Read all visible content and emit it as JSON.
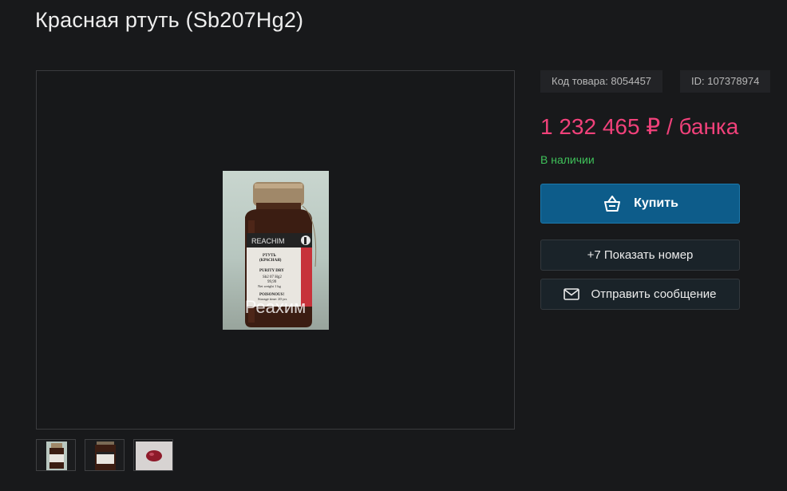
{
  "product": {
    "title": "Красная ртуть (Sb207Hg2)",
    "code_label": "Код товара: 8054457",
    "id_label": "ID: 107378974",
    "price": "1 232 465 ₽ / банка",
    "availability": "В наличии"
  },
  "photo": {
    "watermark": "Реахим",
    "label_brand": "REACHIM",
    "label_lines": [
      "РТУТЬ",
      "(КРАСНАЯ)",
      "PURITY DRY",
      "Sb2 07 Hg2",
      "99,99",
      "Net weight 1 kg",
      "POISONOUS!",
      "Storage time: 20 yrs"
    ]
  },
  "actions": {
    "buy_label": "Купить",
    "phone_label": "+7 Показать номер",
    "message_label": "Отправить сообщение"
  },
  "thumbnails": [
    {
      "name": "thumb-jar-front"
    },
    {
      "name": "thumb-jar-label"
    },
    {
      "name": "thumb-red-substance"
    }
  ],
  "colors": {
    "accent_price": "#f0417a",
    "in_stock": "#3fc25a",
    "buy_button": "#0d5c8a"
  },
  "icons": {
    "buy": "basket-icon",
    "message": "envelope-icon"
  }
}
